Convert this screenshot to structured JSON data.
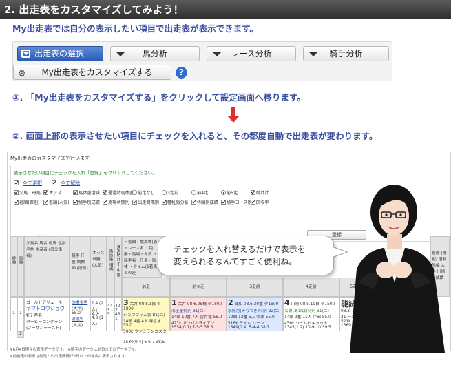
{
  "banner": {
    "title": "2. 出走表をカスタマイズしてみよう！",
    "subtitle": "My出走表では自分の表示したい項目で出走表が表示できます。"
  },
  "tabs": {
    "active": "出走表の選択",
    "horse": "馬分析",
    "race": "レース分析",
    "jockey": "騎手分析",
    "customize": "My出走表をカスタマイズする",
    "help": "?"
  },
  "steps": {
    "step1": "①. 「My出走表をカスタマイズする」をクリックして設定画面へ移ります。",
    "step2": "②. 画面上部の表示させたい項目にチェックを入れると、その都度自動で出走表が変わります。"
  },
  "screenshot": {
    "title": "My出走表のカスタマイズを行います",
    "instruction": "表示させたい項目にチェックを入れ「登録」をクリックしてください。",
    "check_all": "全て選択",
    "uncheck_all": "全て解除",
    "row1": [
      {
        "label": "父馬・母馬",
        "kind": "cb",
        "on": true
      },
      {
        "label": "オッズ",
        "kind": "cb",
        "on": true
      },
      {
        "label": "馬体重増減",
        "kind": "cb",
        "on": true
      },
      {
        "label": "通過時馬体重",
        "kind": "cb",
        "on": true
      },
      {
        "label": "前走なし",
        "kind": "rd",
        "on": false
      },
      {
        "label": "3走前",
        "kind": "rd",
        "on": false
      },
      {
        "label": "前4走",
        "kind": "rd",
        "on": false
      },
      {
        "label": "前5走",
        "kind": "rd",
        "on": true
      },
      {
        "label": "時計計",
        "kind": "cb",
        "on": true
      }
    ],
    "row2": [
      {
        "label": "着順(距別)",
        "kind": "cb",
        "on": true
      },
      {
        "label": "着順(人気)",
        "kind": "cb",
        "on": true
      },
      {
        "label": "騎手別成績",
        "kind": "cb",
        "on": true
      },
      {
        "label": "馬場状態別",
        "kind": "cb",
        "on": true
      },
      {
        "label": "出走間隔別",
        "kind": "cb",
        "on": true
      },
      {
        "label": "種牡馬分析",
        "kind": "cb",
        "on": true
      },
      {
        "label": "枠順別成績",
        "kind": "cb",
        "on": true
      },
      {
        "label": "騎手コース別",
        "kind": "cb",
        "on": true
      },
      {
        "label": "回収率",
        "kind": "cb",
        "on": true
      }
    ],
    "cancel": "カスタマイズをやめて戻る",
    "register": "登録",
    "table": {
      "headers": {
        "waku": "枠番",
        "uma": "馬番",
        "horse_info": "父馬名 馬名 母馬 性齢 毛色 生産者 (母父馬名)",
        "jockey": "騎手 斤量 調教師 (所属)",
        "odds": "オッズ 単勝 (人気)",
        "weight": "馬体重 増減",
        "speed": "通過時計 千 中 後",
        "race_info": "・着順・競馬場(ま ・レース名 ・距離・馬場・人気 ・騎手名・斤量・馬体 ・タイム(1着馬との差",
        "prev1": "前走",
        "prev2": "前々走",
        "prev3": "3走前",
        "prev4": "4走前",
        "prev5": "5走前",
        "right": "着順 (機別) 潘和 船橋 大井 川崎 全成績"
      },
      "row": {
        "waku": "1",
        "uma": "1",
        "sire": "ゴールドアリュール",
        "name": "ヤマトコウショウ",
        "dam": "(ノーザンテースト)",
        "dam2": "タービーロングラン",
        "sex": "牡7 芦毛",
        "jockey": "的場文男",
        "jockey_aff": "(大井)",
        "kinryo": "55.0",
        "trainer": "渡邊知",
        "trainer_aff": "(大井)",
        "odds": "1.4 (2人) 2.0-4.8 (1人)",
        "weight": "445 -5",
        "speed": "427 451",
        "p1_rank": "3",
        "p1_line1": "大井 08.8.1良 ダ1800",
        "p1_line2": "ショウウィム賞 B1(二)",
        "p1_line3": "14頭 4番 4人 寺倉ま 55.0",
        "p1_line4": "500k ウツミランカスター",
        "p1_line5": "1530(0.4) 6-6-7 38.5",
        "p2_rank": "1",
        "p2_line1": "大井 08.6.25稍 ダ1800",
        "p2_line2": "海王星特別 B1(二)",
        "p2_line3": "14頭 10番 7人 吉井竜 55.0",
        "p2_line4": "477k ガンバルライアン",
        "p2_line5": "1554(0.1) 7-5-5 38.5",
        "p3_rank": "2",
        "p3_line1": "浦和 08.6.30重 ダ1500",
        "p3_line2": "水無月(みなづき)特別 B2(二)",
        "p3_line3": "12頭 12番 5人 吹本 55.0",
        "p3_line4": "516k ライム ハーン",
        "p3_line5": "1349(0.4) 5-4-4 38.7",
        "p4_rank": "4",
        "p4_line1": "川崎 08.5.19良 ダ1500",
        "p4_line2": "名翼(あおば)特別 B1(二)",
        "p4_line3": "14頭 9番 11人 戸田 55.0",
        "p4_line4": "456k ワイルドキャット",
        "p4_line5": "1345(1.2) 10-9-10 39.5",
        "p5_label": "能試",
        "p5_line1": "大井 08.3.",
        "p5_line2": "2レース",
        "p5_line3": "521k",
        "p5_line4": "1369",
        "row2_num": "2"
      }
    },
    "foot1": "※6月4日現在の表示データです。 ※騎手のデータは前日までのデータです。",
    "foot2": "※前後走の表示は前走との出走間隔が8日以上の場合に表示されます。"
  },
  "bubble": {
    "line1": "チェックを入れ替えるだけで表示を",
    "line2": "変えられるなんてすごく便利ね。"
  },
  "colors": {
    "banner_bg": "#3b3b3b",
    "accent_blue": "#3a4fa0",
    "active_tab": "#2b5bb8",
    "arrow_red": "#d93030",
    "cell_yellow": "#fff8c0",
    "cell_blue": "#dce8ff",
    "cell_pink": "#ffe0e0"
  }
}
